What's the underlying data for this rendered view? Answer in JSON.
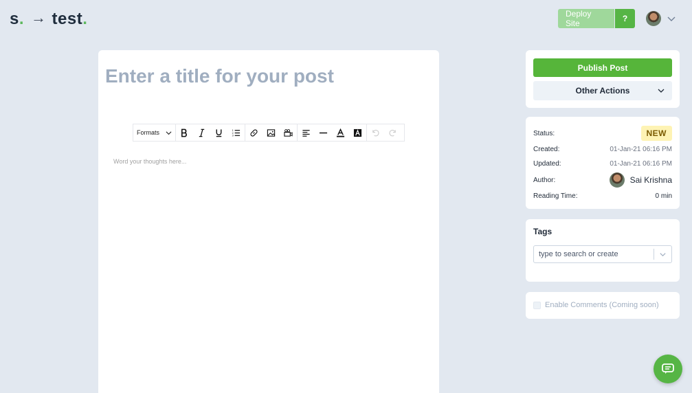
{
  "header": {
    "logo_s": "s",
    "logo_dot": ".",
    "logo_arrow": "→",
    "logo_site": "test",
    "logo_site_dot": ".",
    "deploy_label": "Deploy Site",
    "help_label": "?"
  },
  "editor": {
    "title_placeholder": "Enter a title for your post",
    "formats_label": "Formats",
    "body_placeholder": "Word your thoughts here..."
  },
  "actions": {
    "publish_label": "Publish Post",
    "other_label": "Other Actions"
  },
  "meta": {
    "status_label": "Status:",
    "status_value": "NEW",
    "created_label": "Created:",
    "created_value": "01-Jan-21 06:16 PM",
    "updated_label": "Updated:",
    "updated_value": "01-Jan-21 06:16 PM",
    "author_label": "Author:",
    "author_name": "Sai Krishna",
    "reading_label": "Reading Time:",
    "reading_value": "0 min"
  },
  "tags": {
    "title": "Tags",
    "placeholder": "type to search or create"
  },
  "comments": {
    "label": "Enable Comments (Coming soon)"
  },
  "colors": {
    "accent": "#56b545",
    "background": "#e2e8f0",
    "badge_new": "#fef3b4"
  },
  "icons": [
    "chevron-down-icon",
    "bold-icon",
    "italic-icon",
    "underline-icon",
    "list-icon",
    "link-icon",
    "image-icon",
    "video-icon",
    "align-left-icon",
    "horizontal-rule-icon",
    "text-color-icon",
    "background-color-icon",
    "undo-icon",
    "redo-icon",
    "chat-icon"
  ]
}
